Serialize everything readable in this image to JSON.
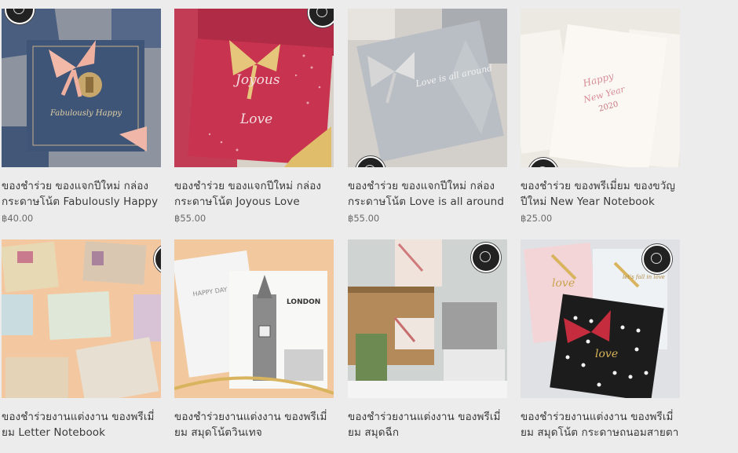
{
  "products": [
    {
      "title": "ของชำร่วย ของแจกปีใหม่ กล่องกระดาษโน้ต Fabulously Happy",
      "price": "฿40.00"
    },
    {
      "title": "ของชำร่วย ของแจกปีใหม่ กล่องกระดาษโน้ต Joyous Love",
      "price": "฿55.00"
    },
    {
      "title": "ของชำร่วย ของแจกปีใหม่ กล่องกระดาษโน้ต Love is all around",
      "price": "฿55.00"
    },
    {
      "title": "ของชำร่วย ของพรีเมี่ยม ของขวัญปีใหม่ New Year Notebook",
      "price": "฿25.00"
    },
    {
      "title": "ของชำร่วยงานแต่งงาน ของพรีเมี่ยม Letter Notebook",
      "price": ""
    },
    {
      "title": "ของชำร่วยงานแต่งงาน ของพรีเมี่ยม สมุดโน้ตวินเทจ",
      "price": ""
    },
    {
      "title": "ของชำร่วยงานแต่งงาน ของพรีเมี่ยม สมุดฉีก",
      "price": ""
    },
    {
      "title": "ของชำร่วยงานแต่งงาน ของพรีเมี่ยม สมุดโน้ต กระดาษถนอมสายตา",
      "price": ""
    }
  ],
  "image_text": {
    "p1": "Fabulously Happy",
    "p2a": "Joyous",
    "p2b": "Love",
    "p3": "Love is all around",
    "p4a": "Happy",
    "p4b": "New Year",
    "p4c": "2020",
    "p6a": "HAPPY DAY",
    "p6b": "LONDON",
    "p8a": "love",
    "p8b": "let's fall in love",
    "p8c": "love"
  },
  "colors": {
    "background": "#ececec",
    "navy_box": "#3e5577",
    "red_box": "#b8304a",
    "grey_box": "#b9bec4",
    "ribbon_pink": "#f0b7a8",
    "ribbon_gold": "#d9b45e"
  }
}
